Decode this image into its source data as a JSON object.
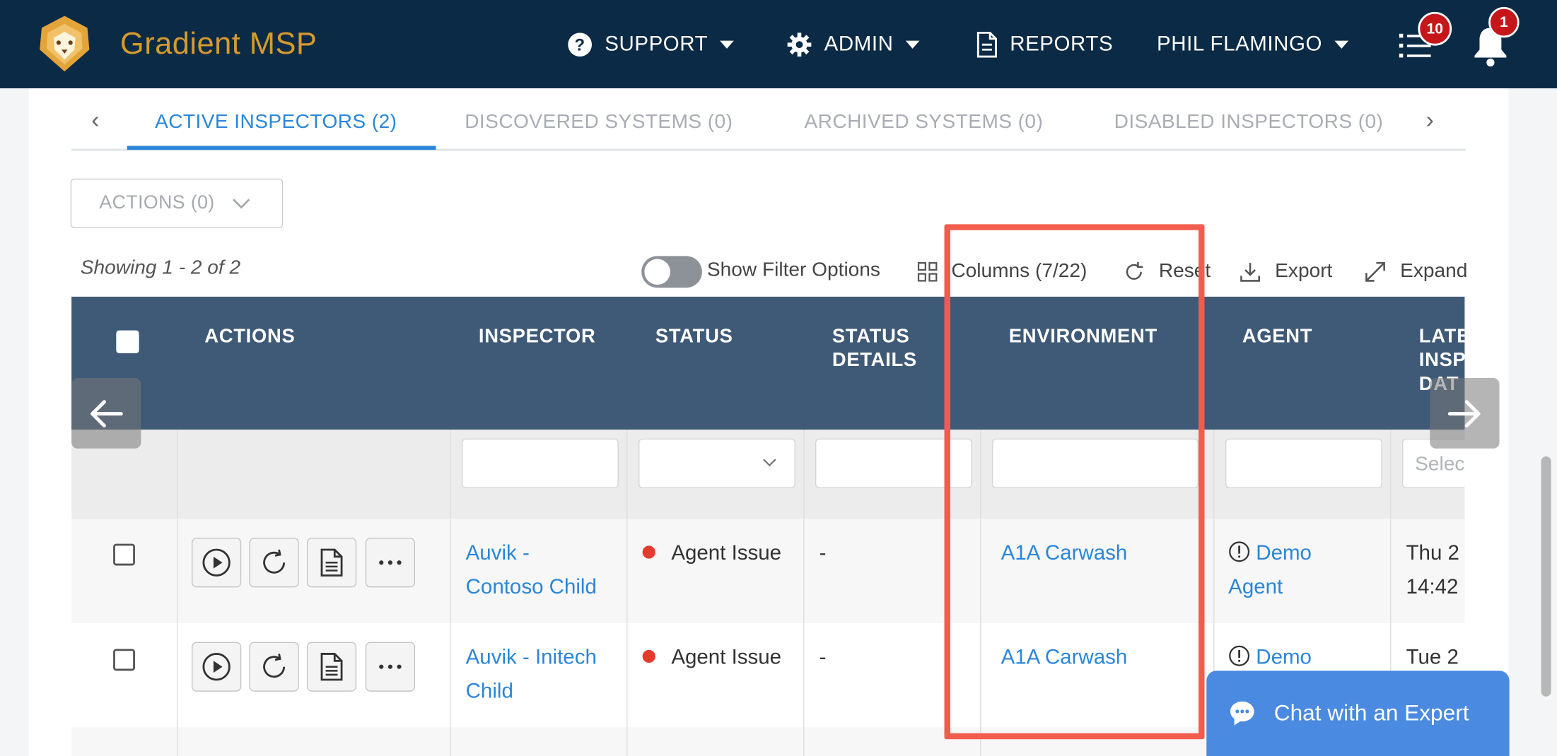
{
  "header": {
    "brand": "Gradient MSP",
    "support": "SUPPORT",
    "admin": "ADMIN",
    "reports": "REPORTS",
    "user": "PHIL FLAMINGO",
    "tasks_count": "10",
    "notifications_count": "1"
  },
  "tabs": [
    {
      "label": "ACTIVE INSPECTORS (2)",
      "active": true
    },
    {
      "label": "DISCOVERED SYSTEMS (0)",
      "active": false
    },
    {
      "label": "ARCHIVED SYSTEMS (0)",
      "active": false
    },
    {
      "label": "DISABLED INSPECTORS (0)",
      "active": false
    }
  ],
  "actions_dropdown": "ACTIONS (0)",
  "toolbar": {
    "showing": "Showing 1 - 2 of 2",
    "filter_toggle": "Show Filter Options",
    "columns": "Columns (7/22)",
    "reset": "Reset",
    "export": "Export",
    "expand": "Expand"
  },
  "table": {
    "headers": {
      "actions": "ACTIONS",
      "inspector": "INSPECTOR",
      "status": "STATUS",
      "status_details_1": "STATUS",
      "status_details_2": "DETAILS",
      "environment": "ENVIRONMENT",
      "agent": "AGENT",
      "latest_1": "LATE",
      "latest_2": "INSP",
      "latest_3": "DAT"
    },
    "select_placeholder": "Selec",
    "rows": [
      {
        "inspector_1": "Auvik -",
        "inspector_2": "Contoso Child",
        "status": "Agent Issue",
        "details": "-",
        "environment": "A1A Carwash",
        "agent_1": "Demo",
        "agent_2": "Agent",
        "latest_1": "Thu 2",
        "latest_2": "14:42"
      },
      {
        "inspector_1": "Auvik - Initech",
        "inspector_2": "Child",
        "status": "Agent Issue",
        "details": "-",
        "environment": "A1A Carwash",
        "agent_1": "Demo",
        "latest_1": "Tue 2"
      }
    ]
  },
  "chat": "Chat with an Expert",
  "colors": {
    "topbar": "#0b2a45",
    "brand": "#d59a2e",
    "accent": "#2b86d8",
    "table_header": "#3f5a76",
    "highlight": "#f25c4d",
    "status_error": "#e53b2f",
    "chat": "#4a8ae0"
  },
  "icons": [
    "lion-logo-icon",
    "help-circle-icon",
    "gear-icon",
    "document-icon",
    "list-icon",
    "bell-icon",
    "grid-icon",
    "refresh-icon",
    "download-icon",
    "expand-icon",
    "play-icon",
    "file-icon",
    "more-icon",
    "arrow-left-icon",
    "arrow-right-icon",
    "chat-bubble-icon"
  ]
}
